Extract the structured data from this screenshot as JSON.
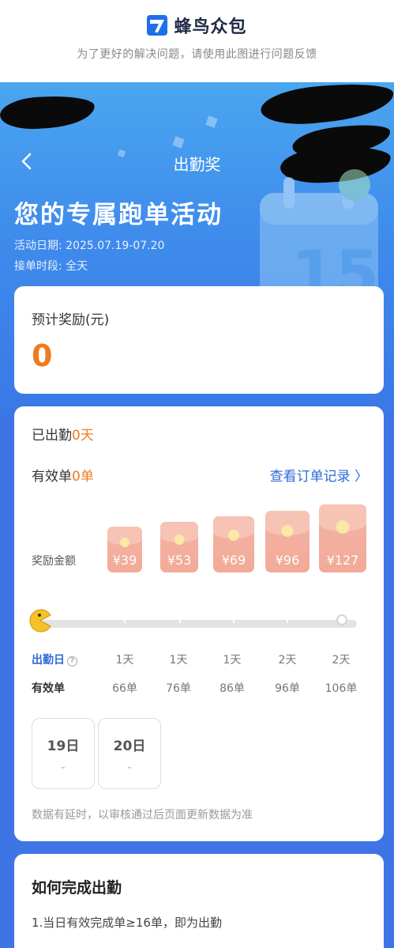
{
  "header": {
    "brand_name": "蜂鸟众包",
    "feedback_tip": "为了更好的解决问题，请使用此图进行问题反馈"
  },
  "nav": {
    "title": "出勤奖"
  },
  "hero": {
    "title": "您的专属跑单活动",
    "activity_date": "活动日期: 2025.07.19-07.20",
    "order_period": "接单时段: 全天"
  },
  "reward": {
    "label": "预计奖励(元)",
    "value": "0"
  },
  "attendance": {
    "attended_prefix": "已出勤",
    "attended_value": "0天",
    "valid_prefix": "有效单",
    "valid_value": "0单",
    "order_link": "查看订单记录 〉",
    "amount_label": "奖励金额",
    "envelopes": [
      "¥39",
      "¥53",
      "¥69",
      "¥96",
      "¥127"
    ],
    "progress": 0,
    "days_label": "出勤日",
    "orders_label": "有效单",
    "days": [
      "1天",
      "1天",
      "1天",
      "2天",
      "2天"
    ],
    "orders": [
      "66单",
      "76单",
      "86单",
      "96单",
      "106单"
    ],
    "day_boxes": [
      {
        "day": "19日",
        "value": "-"
      },
      {
        "day": "20日",
        "value": "-"
      }
    ],
    "delay_note": "数据有延时，以审核通过后页面更新数据为准"
  },
  "howto": {
    "title": "如何完成出勤",
    "rule_1": "1.当日有效完成单≥16单，即为出勤"
  },
  "colors": {
    "accent_orange": "#ee7b1e",
    "link_blue": "#2f6ad9",
    "hero_blue": "#3f8cec"
  }
}
